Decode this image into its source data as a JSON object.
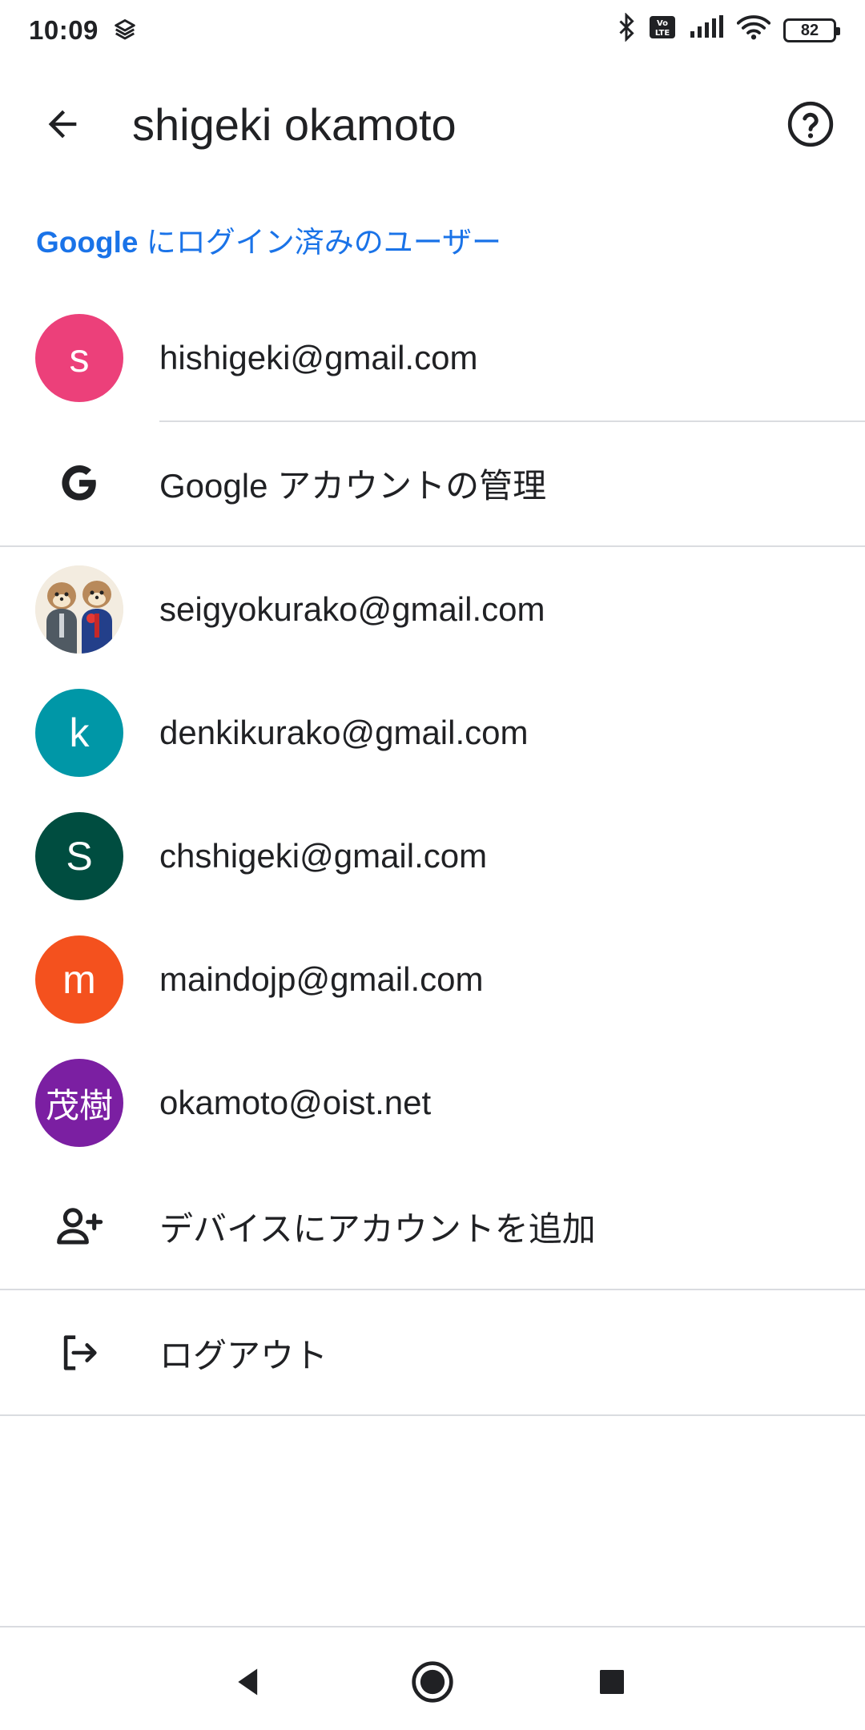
{
  "status_bar": {
    "time": "10:09",
    "battery": "82",
    "icons": [
      "stack-icon",
      "bluetooth-icon",
      "volte-icon",
      "signal-icon",
      "wifi-icon",
      "battery-icon"
    ]
  },
  "app_bar": {
    "title": "shigeki okamoto"
  },
  "section": {
    "google_word": "Google",
    "rest": " にログイン済みのユーザー"
  },
  "current_account": {
    "avatar_letter": "s",
    "avatar_color": "#ec407a",
    "email": "hishigeki@gmail.com"
  },
  "manage_account": {
    "label": "Google アカウントの管理"
  },
  "accounts": [
    {
      "avatar_letter": "",
      "avatar_color": "#e8e0d0",
      "email": "seigyokurako@gmail.com",
      "image": true
    },
    {
      "avatar_letter": "k",
      "avatar_color": "#0097a7",
      "email": "denkikurako@gmail.com"
    },
    {
      "avatar_letter": "S",
      "avatar_color": "#004d40",
      "email": "chshigeki@gmail.com"
    },
    {
      "avatar_letter": "m",
      "avatar_color": "#f4511e",
      "email": "maindojp@gmail.com"
    },
    {
      "avatar_letter": "茂樹",
      "avatar_color": "#7b1fa2",
      "email": "okamoto@oist.net"
    }
  ],
  "actions": {
    "add_account": "デバイスにアカウントを追加",
    "logout": "ログアウト"
  }
}
